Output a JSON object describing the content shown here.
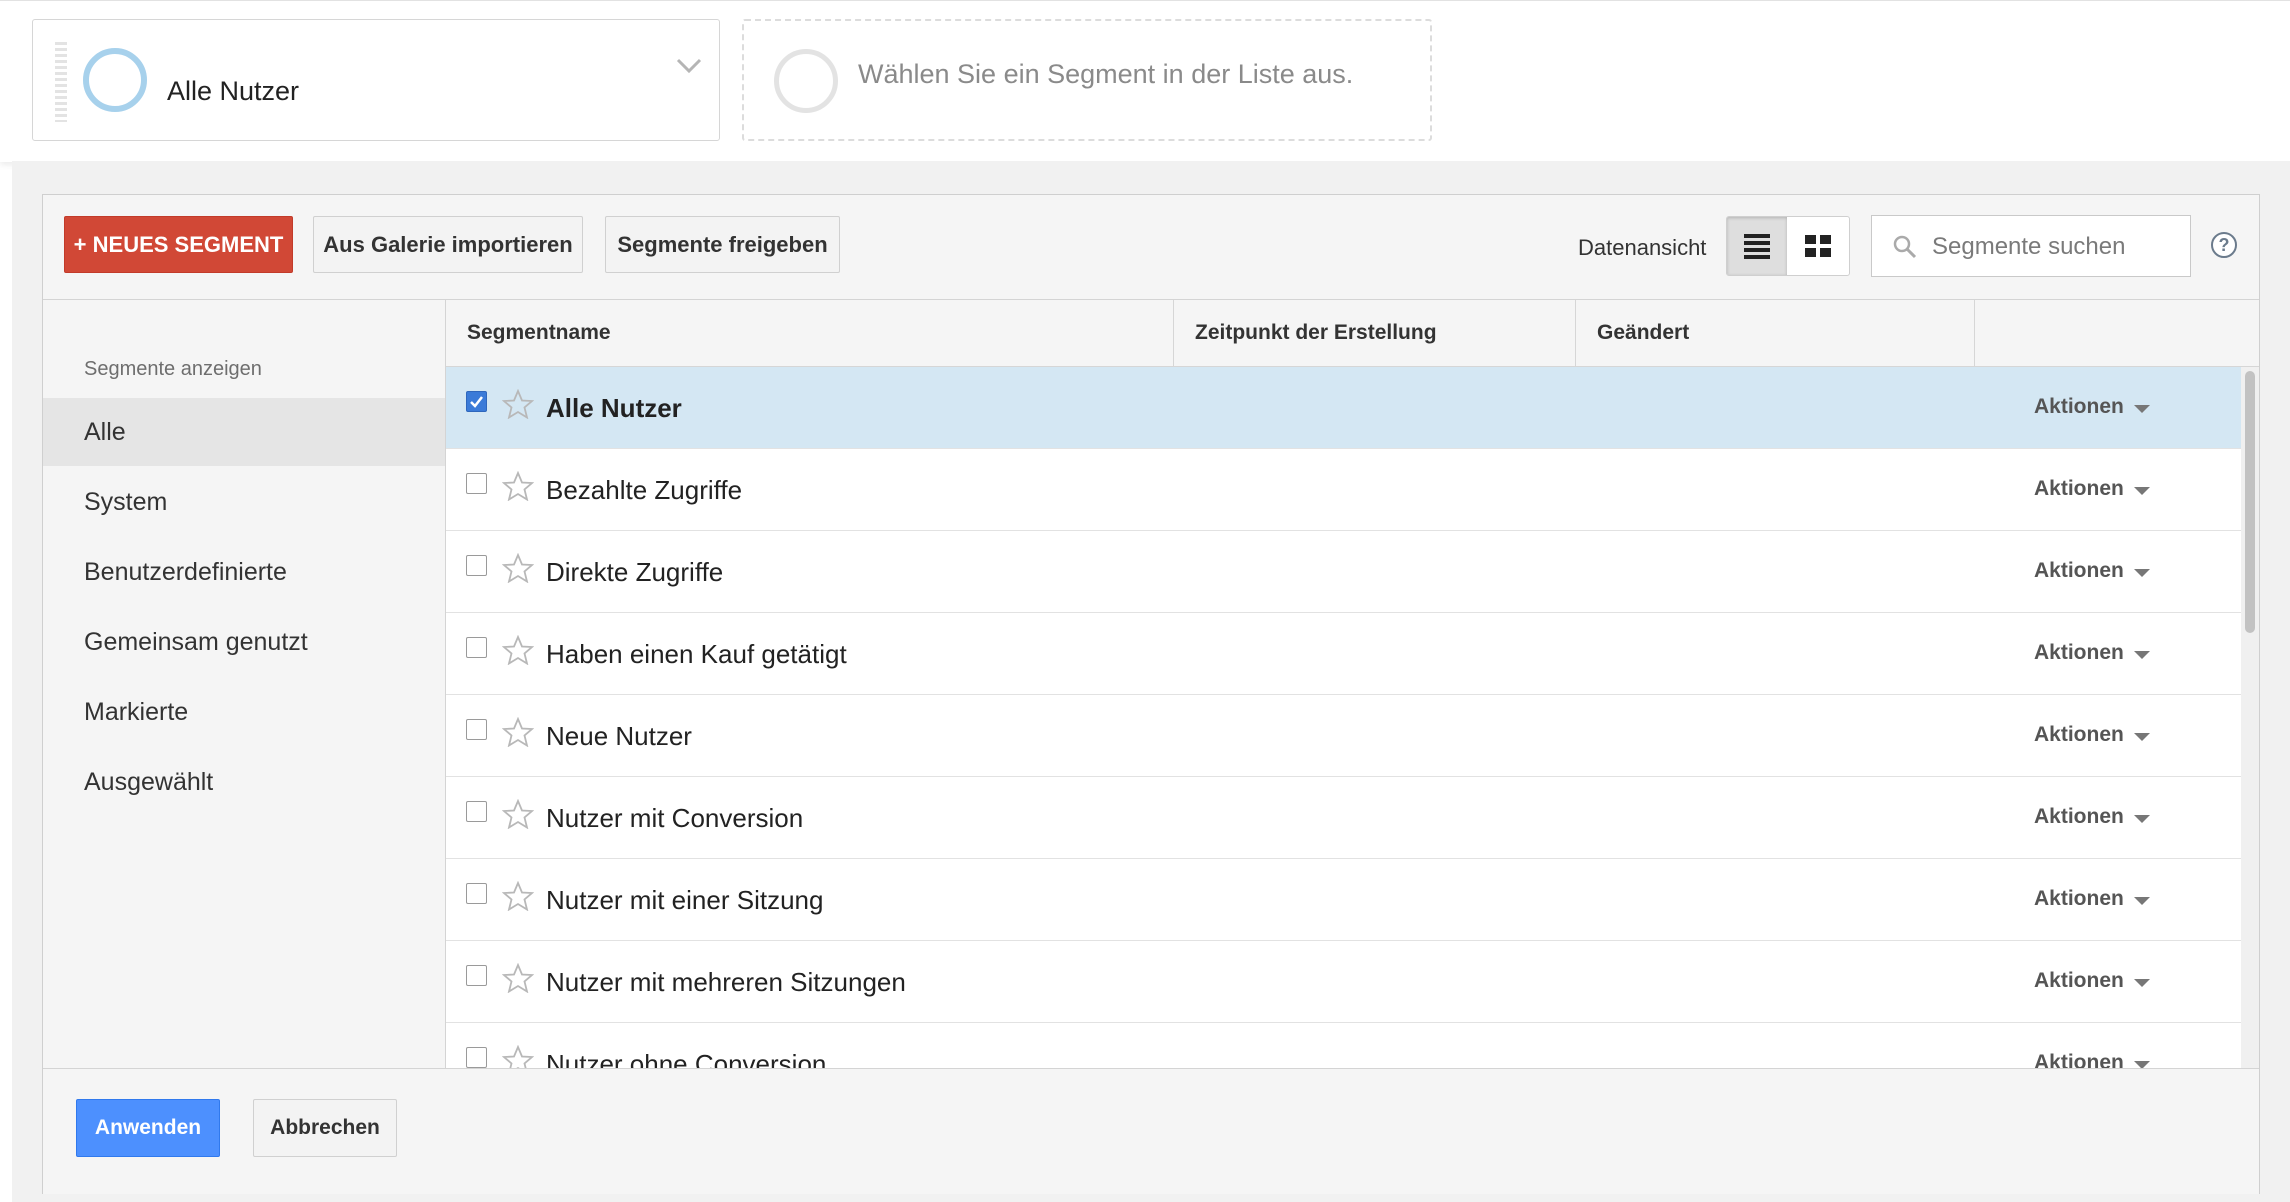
{
  "segment_bar": {
    "active_segment": "Alle Nutzer",
    "empty_slot_text": "Wählen Sie ein Segment in der Liste aus."
  },
  "toolbar": {
    "new_segment_label": "+ NEUES SEGMENT",
    "import_label": "Aus Galerie importieren",
    "share_label": "Segmente freigeben",
    "data_view_label": "Datenansicht",
    "search_placeholder": "Segmente suchen",
    "help_label": "?"
  },
  "nav": {
    "heading": "Segmente anzeigen",
    "items": [
      {
        "label": "Alle",
        "active": true
      },
      {
        "label": "System",
        "active": false
      },
      {
        "label": "Benutzerdefinierte",
        "active": false
      },
      {
        "label": "Gemeinsam genutzt",
        "active": false
      },
      {
        "label": "Markierte",
        "active": false
      },
      {
        "label": "Ausgewählt",
        "active": false
      }
    ]
  },
  "table": {
    "columns": [
      "Segmentname",
      "Zeitpunkt der Erstellung",
      "Geändert"
    ],
    "actions_label": "Aktionen",
    "rows": [
      {
        "name": "Alle Nutzer",
        "checked": true
      },
      {
        "name": "Bezahlte Zugriffe",
        "checked": false
      },
      {
        "name": "Direkte Zugriffe",
        "checked": false
      },
      {
        "name": "Haben einen Kauf getätigt",
        "checked": false
      },
      {
        "name": "Neue Nutzer",
        "checked": false
      },
      {
        "name": "Nutzer mit Conversion",
        "checked": false
      },
      {
        "name": "Nutzer mit einer Sitzung",
        "checked": false
      },
      {
        "name": "Nutzer mit mehreren Sitzungen",
        "checked": false
      },
      {
        "name": "Nutzer ohne Conversion",
        "checked": false
      }
    ]
  },
  "footer": {
    "apply_label": "Anwenden",
    "cancel_label": "Abbrechen"
  },
  "colors": {
    "primary_red": "#d14836",
    "apply_blue": "#4d90fe",
    "selected_row": "#d4e7f3",
    "ring_active": "#a7d1ec"
  },
  "icons": [
    "chevron-down-icon",
    "list-view-icon",
    "grid-view-icon",
    "search-icon",
    "help-icon",
    "star-icon",
    "checkbox-icon",
    "caret-down-icon"
  ]
}
